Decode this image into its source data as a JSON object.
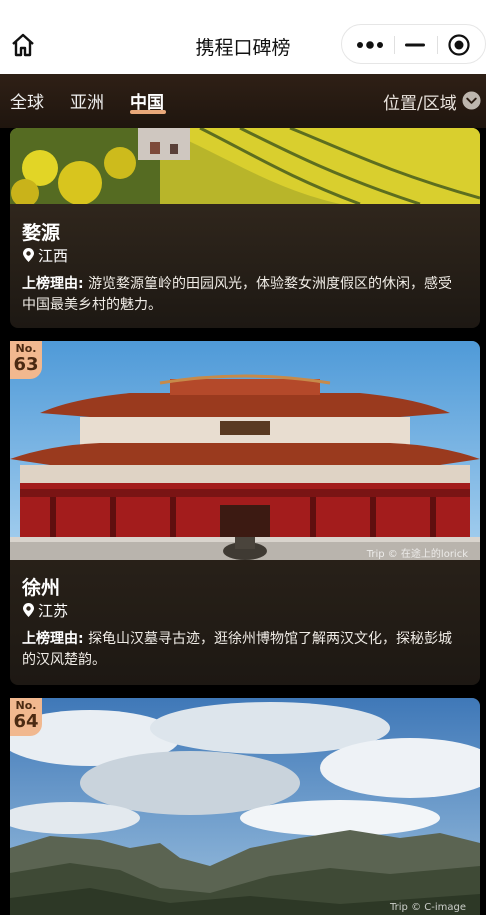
{
  "header": {
    "title": "携程口碑榜"
  },
  "tabs": [
    {
      "label": "全球",
      "active": false
    },
    {
      "label": "亚洲",
      "active": false
    },
    {
      "label": "中国",
      "active": true
    }
  ],
  "region_filter": {
    "label": "位置/区域"
  },
  "cards": [
    {
      "name": "婺源",
      "location": "江西",
      "reason_tag": "上榜理由:",
      "reason": "游览婺源篁岭的田园风光，体验婺女洲度假区的休闲，感受中国最美乡村的魅力。"
    },
    {
      "rank_prefix": "No.",
      "rank": "63",
      "name": "徐州",
      "location": "江苏",
      "reason_tag": "上榜理由:",
      "reason": "探龟山汉墓寻古迹，逛徐州博物馆了解两汉文化，探秘彭城的汉风楚韵。",
      "photo_credit": "Trip © 在途上的lorick"
    },
    {
      "rank_prefix": "No.",
      "rank": "64",
      "photo_credit": "Trip © C-image"
    }
  ],
  "colors": {
    "accent": "#f1b88f",
    "tab_bar": "#2a1c12",
    "card_bg": "#2d241b"
  },
  "icons": {
    "home": "home-icon",
    "more": "more-dots-icon",
    "minimize": "minimize-icon",
    "close": "target-close-icon",
    "dropdown": "chevron-down-icon",
    "location": "location-pin-icon"
  }
}
